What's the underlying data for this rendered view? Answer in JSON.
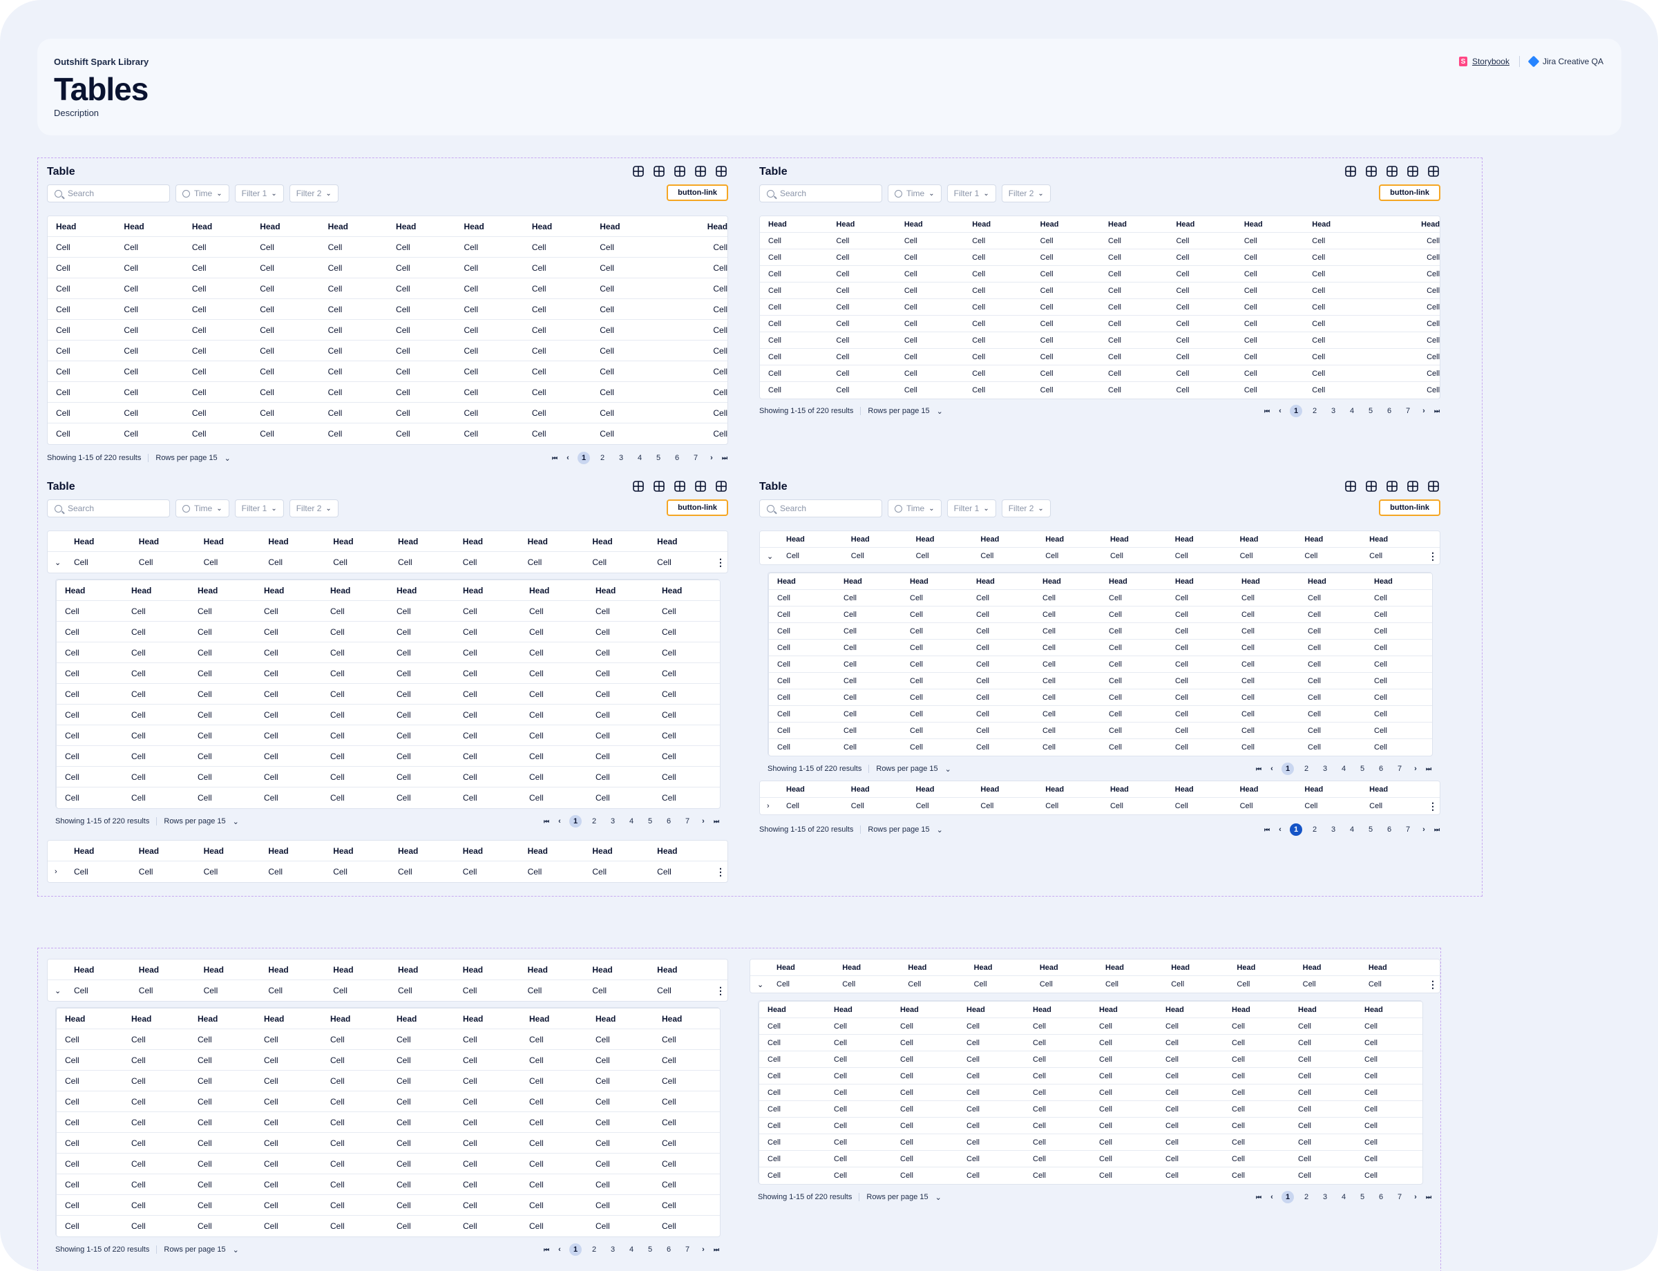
{
  "header": {
    "library": "Outshift Spark Library",
    "title": "Tables",
    "description": "Description",
    "links": [
      {
        "label": "Storybook",
        "icon": "storybook-icon"
      },
      {
        "label": "Jira Creative QA",
        "icon": "jira-icon"
      }
    ]
  },
  "table": {
    "title": "Table",
    "search_placeholder": "Search",
    "filters": [
      "Time",
      "Filter 1",
      "Filter 2"
    ],
    "button_link": "button-link",
    "head": "Head",
    "cell": "Cell",
    "showing": "Showing 1-15 of 220 results",
    "rows_per_page": "Rows per page 15",
    "pages": [
      "1",
      "2",
      "3",
      "4",
      "5",
      "6",
      "7"
    ]
  },
  "colors": {
    "accent_border": "#f5a623",
    "current_page": "#c9d6f0",
    "current_page_dark": "#1554c6",
    "frame_dash": "#c7a8f0",
    "storybook": "#ff4785",
    "jira": "#2684ff"
  }
}
